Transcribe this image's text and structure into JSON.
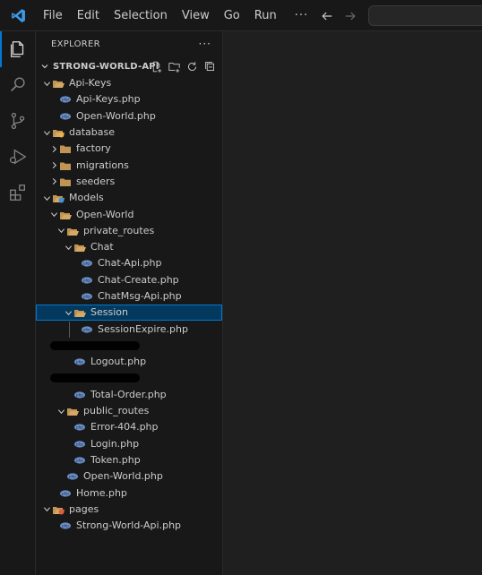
{
  "titlebar": {
    "menu": [
      "File",
      "Edit",
      "Selection",
      "View",
      "Go",
      "Run",
      "···"
    ],
    "back_icon": "arrow-left-icon",
    "forward_icon": "arrow-right-icon"
  },
  "activitybar": {
    "items": [
      "files-icon",
      "search-icon",
      "source-control-icon",
      "run-debug-icon",
      "extensions-icon"
    ]
  },
  "explorer": {
    "title": "EXPLORER",
    "more": "···",
    "section_title": "STRONG-WORLD-API",
    "section_actions": [
      "new-file-icon",
      "new-folder-icon",
      "refresh-icon",
      "collapse-all-icon"
    ],
    "rows": [
      {
        "label": "Api-Keys",
        "type": "folder",
        "depth": 1,
        "open": true
      },
      {
        "label": "Api-Keys.php",
        "type": "php",
        "depth": 2
      },
      {
        "label": "Open-World.php",
        "type": "php",
        "depth": 2
      },
      {
        "label": "database",
        "type": "folder-db",
        "depth": 1,
        "open": true
      },
      {
        "label": "factory",
        "type": "folder",
        "depth": 2,
        "open": false
      },
      {
        "label": "migrations",
        "type": "folder",
        "depth": 2,
        "open": false
      },
      {
        "label": "seeders",
        "type": "folder",
        "depth": 2,
        "open": false
      },
      {
        "label": "Models",
        "type": "folder-models",
        "depth": 1,
        "open": true
      },
      {
        "label": "Open-World",
        "type": "folder",
        "depth": 2,
        "open": true
      },
      {
        "label": "private_routes",
        "type": "folder",
        "depth": 3,
        "open": true
      },
      {
        "label": "Chat",
        "type": "folder",
        "depth": 4,
        "open": true
      },
      {
        "label": "Chat-Api.php",
        "type": "php",
        "depth": 5
      },
      {
        "label": "Chat-Create.php",
        "type": "php",
        "depth": 5
      },
      {
        "label": "ChatMsg-Api.php",
        "type": "php",
        "depth": 5
      },
      {
        "label": "Session",
        "type": "folder",
        "depth": 4,
        "open": true,
        "selected": true
      },
      {
        "label": "SessionExpire.php",
        "type": "php",
        "depth": 5
      },
      {
        "label": "",
        "type": "redacted",
        "depth": 4
      },
      {
        "label": "Logout.php",
        "type": "php",
        "depth": 4
      },
      {
        "label": "",
        "type": "redacted",
        "depth": 4
      },
      {
        "label": "Total-Order.php",
        "type": "php",
        "depth": 4
      },
      {
        "label": "public_routes",
        "type": "folder",
        "depth": 3,
        "open": true
      },
      {
        "label": "Error-404.php",
        "type": "php",
        "depth": 4
      },
      {
        "label": "Login.php",
        "type": "php",
        "depth": 4
      },
      {
        "label": "Token.php",
        "type": "php",
        "depth": 4
      },
      {
        "label": "Open-World.php",
        "type": "php",
        "depth": 3
      },
      {
        "label": "Home.php",
        "type": "php",
        "depth": 2
      },
      {
        "label": "pages",
        "type": "folder-pages",
        "depth": 1,
        "open": true
      },
      {
        "label": "Strong-World-Api.php",
        "type": "php",
        "depth": 2
      }
    ]
  },
  "colors": {
    "accent": "#0078d4",
    "selected_bg": "#04395e",
    "folder": "#c09553",
    "php": "#6a8fc7",
    "db_badge": "#e8b34a",
    "models_badge": "#4a90d9",
    "pages_badge": "#e05d44"
  }
}
